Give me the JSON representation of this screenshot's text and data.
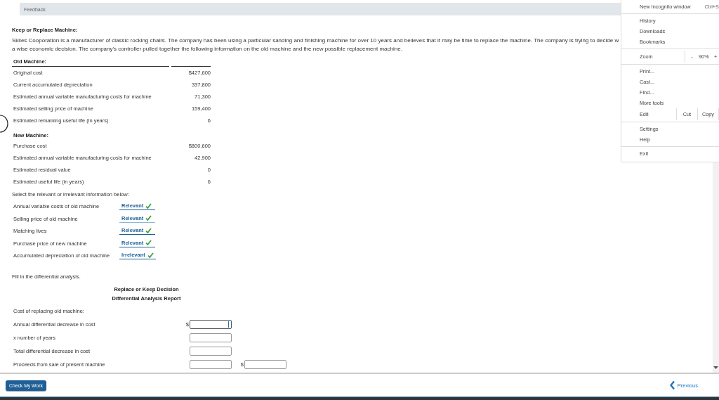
{
  "feedback_bar": {
    "label": "Feedback"
  },
  "problem": {
    "title": "Keep or Replace Machine:",
    "paragraph_lines": [
      "Skiles Cooporation is a manufacturer of classic rocking chairs. The company has been using a particular sanding and finishing machine for over 10 years and believes that it may be time to replace the machine. The company is trying to decide w",
      "a wise economic decision. The company's controller pulled together the following information on the old machine and the new possible replacement machine."
    ]
  },
  "old_machine": {
    "heading": "Old Machine:",
    "rows": [
      {
        "label": "Original cost",
        "value": "$427,600"
      },
      {
        "label": "Current accumulated depreciation",
        "value": "337,800"
      },
      {
        "label": "Estimated annual variable manufacturing costs for machine",
        "value": "71,300"
      },
      {
        "label": "Estimated selling price of machine",
        "value": "159,400"
      },
      {
        "label": "Estimated remaining useful life (in years)",
        "value": "6"
      }
    ]
  },
  "new_machine": {
    "heading": "New Machine:",
    "rows": [
      {
        "label": "Purchase cost",
        "value": "$800,600"
      },
      {
        "label": "Estimated annual variable manufacturing costs for machine",
        "value": "42,900"
      },
      {
        "label": "Estimated residual value",
        "value": "0"
      },
      {
        "label": "Estimated useful life (in years)",
        "value": "6"
      }
    ]
  },
  "relevance": {
    "instruction": "Select the relevant or irrelevant information below:",
    "items": [
      {
        "label": "Annual variable costs of old machine",
        "answer": "Relevant",
        "correct": true,
        "focused": false
      },
      {
        "label": "Selling price of old machine",
        "answer": "Relevant",
        "correct": true,
        "focused": true
      },
      {
        "label": "Matching lives",
        "answer": "Relevant",
        "correct": true,
        "focused": false
      },
      {
        "label": "Purchase price of new machine",
        "answer": "Relevant",
        "correct": true,
        "focused": false
      },
      {
        "label": "Accumulated depreciation of old machine",
        "answer": "Irrelevant",
        "correct": true,
        "focused": false
      }
    ]
  },
  "analysis": {
    "instruction": "Fill in the differential analysis.",
    "title_lines": [
      "Replace or Keep Decision",
      "Differential Analysis Report"
    ],
    "section": "Cost of replacing old machine:",
    "rows": [
      {
        "label": "Annual differential decrease in cost",
        "fields": [
          {
            "prefix": "$",
            "focused": true
          }
        ]
      },
      {
        "label": "x number of years",
        "fields": [
          {
            "focused": false
          }
        ]
      },
      {
        "label": "Total differential decrease in cost",
        "fields": [
          {
            "focused": false
          }
        ]
      },
      {
        "label": "Proceeds from sale of present machine",
        "fields": [
          {
            "focused": false
          },
          {
            "prefix": "$",
            "focused": false
          }
        ]
      }
    ]
  },
  "footer": {
    "check_button": "Check My Work",
    "previous_link": "Previous"
  },
  "browser_menu": {
    "items": [
      {
        "kind": "shortcut",
        "label": "New Incognito window",
        "shortcut": "Ctrl+S"
      },
      {
        "kind": "separator"
      },
      {
        "kind": "item",
        "label": "History"
      },
      {
        "kind": "item",
        "label": "Downloads"
      },
      {
        "kind": "item",
        "label": "Bookmarks"
      },
      {
        "kind": "separator"
      },
      {
        "kind": "zoom",
        "label": "Zoom",
        "minus": "-",
        "value": "90%",
        "plus": "+"
      },
      {
        "kind": "separator"
      },
      {
        "kind": "item",
        "label": "Print..."
      },
      {
        "kind": "item",
        "label": "Cast..."
      },
      {
        "kind": "item",
        "label": "Find..."
      },
      {
        "kind": "item",
        "label": "More tools"
      },
      {
        "kind": "edit",
        "label": "Edit",
        "actions": [
          "Cut",
          "Copy"
        ]
      },
      {
        "kind": "separator"
      },
      {
        "kind": "item",
        "label": "Settings"
      },
      {
        "kind": "item",
        "label": "Help"
      },
      {
        "kind": "separator"
      },
      {
        "kind": "item",
        "label": "Exit"
      }
    ]
  }
}
